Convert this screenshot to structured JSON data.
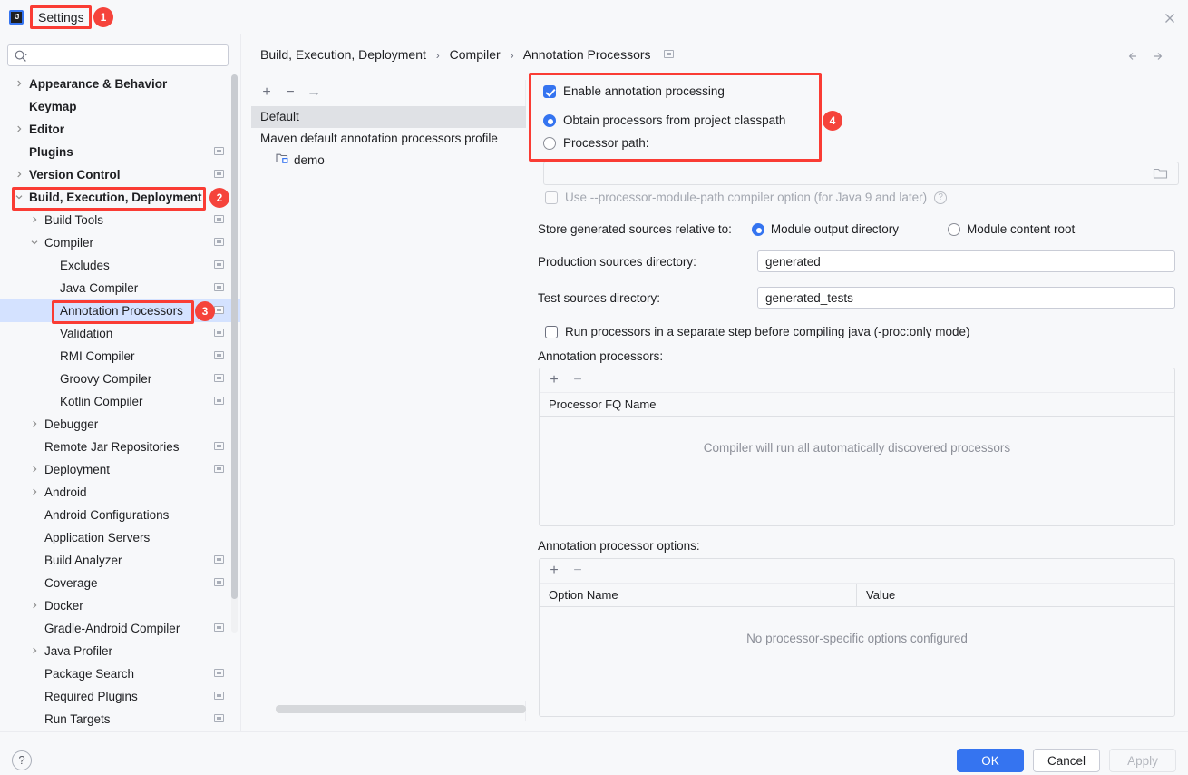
{
  "window": {
    "title": "Settings",
    "logo_text": "IJ",
    "close_icon": "close-icon"
  },
  "search": {
    "value": "",
    "placeholder": ""
  },
  "sidebar": {
    "items": [
      {
        "label": "Appearance & Behavior",
        "indent": 0,
        "chevron": "right",
        "bold": true,
        "mark": false,
        "selected": false
      },
      {
        "label": "Keymap",
        "indent": 0,
        "chevron": "",
        "bold": true,
        "mark": false,
        "selected": false
      },
      {
        "label": "Editor",
        "indent": 0,
        "chevron": "right",
        "bold": true,
        "mark": false,
        "selected": false
      },
      {
        "label": "Plugins",
        "indent": 0,
        "chevron": "",
        "bold": true,
        "mark": true,
        "selected": false
      },
      {
        "label": "Version Control",
        "indent": 0,
        "chevron": "right",
        "bold": true,
        "mark": true,
        "selected": false
      },
      {
        "label": "Build, Execution, Deployment",
        "indent": 0,
        "chevron": "down",
        "bold": true,
        "mark": false,
        "selected": false
      },
      {
        "label": "Build Tools",
        "indent": 1,
        "chevron": "right",
        "bold": false,
        "mark": true,
        "selected": false
      },
      {
        "label": "Compiler",
        "indent": 1,
        "chevron": "down",
        "bold": false,
        "mark": true,
        "selected": false
      },
      {
        "label": "Excludes",
        "indent": 2,
        "chevron": "",
        "bold": false,
        "mark": true,
        "selected": false
      },
      {
        "label": "Java Compiler",
        "indent": 2,
        "chevron": "",
        "bold": false,
        "mark": true,
        "selected": false
      },
      {
        "label": "Annotation Processors",
        "indent": 2,
        "chevron": "",
        "bold": false,
        "mark": true,
        "selected": true
      },
      {
        "label": "Validation",
        "indent": 2,
        "chevron": "",
        "bold": false,
        "mark": true,
        "selected": false
      },
      {
        "label": "RMI Compiler",
        "indent": 2,
        "chevron": "",
        "bold": false,
        "mark": true,
        "selected": false
      },
      {
        "label": "Groovy Compiler",
        "indent": 2,
        "chevron": "",
        "bold": false,
        "mark": true,
        "selected": false
      },
      {
        "label": "Kotlin Compiler",
        "indent": 2,
        "chevron": "",
        "bold": false,
        "mark": true,
        "selected": false
      },
      {
        "label": "Debugger",
        "indent": 1,
        "chevron": "right",
        "bold": false,
        "mark": false,
        "selected": false
      },
      {
        "label": "Remote Jar Repositories",
        "indent": 1,
        "chevron": "",
        "bold": false,
        "mark": true,
        "selected": false
      },
      {
        "label": "Deployment",
        "indent": 1,
        "chevron": "right",
        "bold": false,
        "mark": true,
        "selected": false
      },
      {
        "label": "Android",
        "indent": 1,
        "chevron": "right",
        "bold": false,
        "mark": false,
        "selected": false
      },
      {
        "label": "Android Configurations",
        "indent": 1,
        "chevron": "",
        "bold": false,
        "mark": false,
        "selected": false
      },
      {
        "label": "Application Servers",
        "indent": 1,
        "chevron": "",
        "bold": false,
        "mark": false,
        "selected": false
      },
      {
        "label": "Build Analyzer",
        "indent": 1,
        "chevron": "",
        "bold": false,
        "mark": true,
        "selected": false
      },
      {
        "label": "Coverage",
        "indent": 1,
        "chevron": "",
        "bold": false,
        "mark": true,
        "selected": false
      },
      {
        "label": "Docker",
        "indent": 1,
        "chevron": "right",
        "bold": false,
        "mark": false,
        "selected": false
      },
      {
        "label": "Gradle-Android Compiler",
        "indent": 1,
        "chevron": "",
        "bold": false,
        "mark": true,
        "selected": false
      },
      {
        "label": "Java Profiler",
        "indent": 1,
        "chevron": "right",
        "bold": false,
        "mark": false,
        "selected": false
      },
      {
        "label": "Package Search",
        "indent": 1,
        "chevron": "",
        "bold": false,
        "mark": true,
        "selected": false
      },
      {
        "label": "Required Plugins",
        "indent": 1,
        "chevron": "",
        "bold": false,
        "mark": true,
        "selected": false
      },
      {
        "label": "Run Targets",
        "indent": 1,
        "chevron": "",
        "bold": false,
        "mark": true,
        "selected": false
      }
    ]
  },
  "breadcrumb": {
    "segments": [
      "Build, Execution, Deployment",
      "Compiler",
      "Annotation Processors"
    ],
    "separator": "›"
  },
  "nav": {
    "back_icon": "arrow-left-icon",
    "forward_icon": "arrow-right-icon"
  },
  "profiles": {
    "toolbar": {
      "add": "+",
      "remove": "−",
      "move": "→"
    },
    "rows": [
      {
        "label": "Default",
        "selected": true,
        "type": "profile"
      },
      {
        "label": "Maven default annotation processors profile",
        "selected": false,
        "type": "profile"
      },
      {
        "label": "demo",
        "selected": false,
        "type": "module"
      }
    ]
  },
  "main": {
    "enable_annotation_processing": {
      "label": "Enable annotation processing",
      "checked": true
    },
    "source_mode": {
      "selected": "obtain_from_classpath",
      "options": [
        {
          "id": "obtain_from_classpath",
          "label": "Obtain processors from project classpath"
        },
        {
          "id": "processor_path",
          "label": "Processor path:"
        }
      ]
    },
    "processor_path_field": {
      "value": "",
      "placeholder": "",
      "disabled": true,
      "browse_icon": "folder-icon"
    },
    "processor_module_path": {
      "label": "Use --processor-module-path compiler option (for Java 9 and later)",
      "checked": false,
      "disabled": true,
      "help_icon": "help-icon"
    },
    "store_generated": {
      "label": "Store generated sources relative to:",
      "selected": "module_output_directory",
      "options": [
        {
          "id": "module_output_directory",
          "label": "Module output directory"
        },
        {
          "id": "module_content_root",
          "label": "Module content root"
        }
      ]
    },
    "production_sources": {
      "label": "Production sources directory:",
      "value": "generated"
    },
    "test_sources": {
      "label": "Test sources directory:",
      "value": "generated_tests"
    },
    "run_separate_step": {
      "label": "Run processors in a separate step before compiling java (-proc:only mode)",
      "checked": false
    },
    "processors_table": {
      "title": "Annotation processors:",
      "toolbar": {
        "add": "+",
        "remove": "−"
      },
      "columns": [
        "Processor FQ Name"
      ],
      "rows": [],
      "empty_text": "Compiler will run all automatically discovered processors"
    },
    "options_table": {
      "title": "Annotation processor options:",
      "toolbar": {
        "add": "+",
        "remove": "−"
      },
      "columns": [
        "Option Name",
        "Value"
      ],
      "rows": [],
      "empty_text": "No processor-specific options configured"
    }
  },
  "footer": {
    "help_label": "?",
    "ok_label": "OK",
    "cancel_label": "Cancel",
    "apply_label": "Apply",
    "apply_disabled": true
  },
  "annotations": {
    "badges": [
      {
        "number": "1"
      },
      {
        "number": "2"
      },
      {
        "number": "3"
      },
      {
        "number": "4"
      }
    ],
    "accent_color": "#F5433B"
  },
  "colors": {
    "primary_blue": "#3574F0",
    "selection_blue": "#D4E2FF",
    "annotation_red": "#F5433B",
    "background": "#F7F8FA"
  }
}
